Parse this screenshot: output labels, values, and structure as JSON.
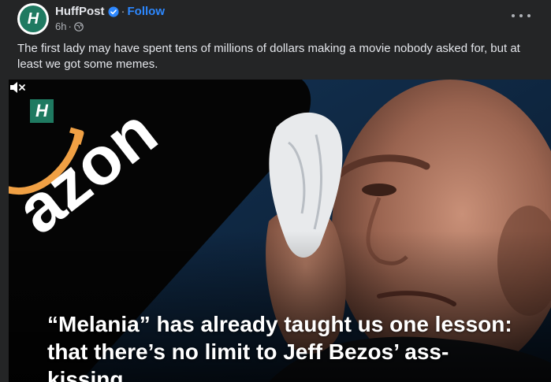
{
  "header": {
    "page_name": "HuffPost",
    "separator": "·",
    "follow_label": "Follow",
    "timestamp": "6h",
    "time_separator": "·",
    "avatar_letter": "H",
    "verified_icon": "verified-badge-icon",
    "audience_icon": "globe-icon",
    "more_icon": "more-options-icon"
  },
  "caption": "The first lady may have spent tens of millions of dollars making a movie nobody asked for, but at least we got some memes.",
  "media": {
    "logo_letter": "H",
    "background_text": "azon",
    "headline_line1": "“Melania” has already taught us one lesson:",
    "headline_line2": "that there’s no limit to Jeff Bezos’ ass-kissing",
    "mute_icon": "muted-speaker-icon"
  },
  "colors": {
    "background": "#242526",
    "text_primary": "#e4e6eb",
    "text_secondary": "#b0b3b8",
    "follow_blue": "#2d88ff",
    "brand_green": "#1f7a61",
    "amazon_orange": "#f0a044"
  }
}
